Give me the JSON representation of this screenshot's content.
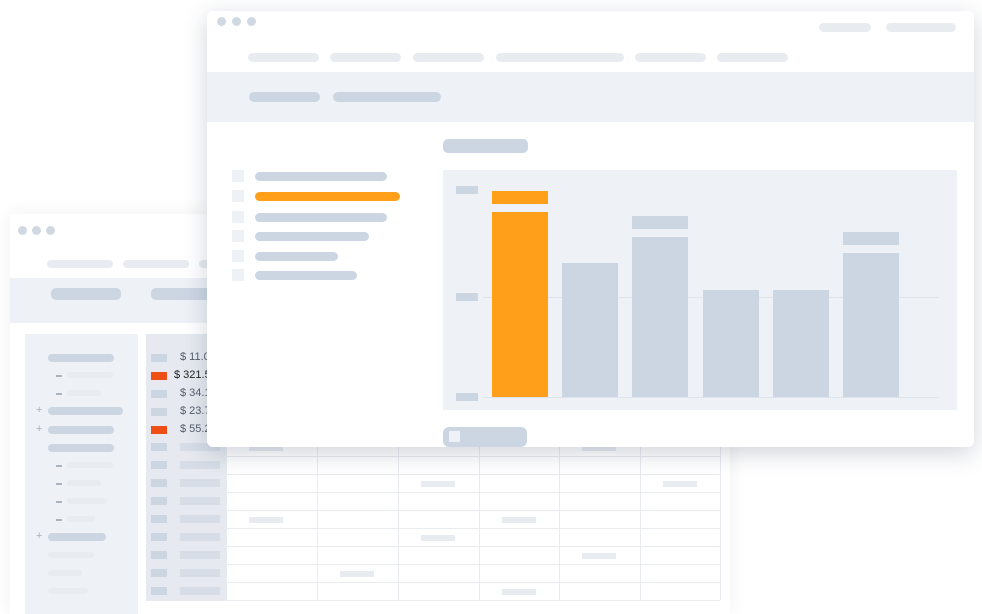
{
  "back_window": {
    "amounts": [
      "$ 11.0",
      "$ 321.5",
      "$ 34.1",
      "$ 23.7",
      "$ 55.2"
    ],
    "highlighted_rows": [
      1,
      4
    ]
  },
  "front_window": {
    "nav_items": 6,
    "active_nav_index": 1
  },
  "chart_data": {
    "type": "bar",
    "categories": [
      "",
      "",
      "",
      "",
      "",
      ""
    ],
    "values": [
      185,
      134,
      160,
      107,
      107,
      144
    ],
    "highlight_index": 0,
    "ylim": [
      0,
      200
    ],
    "grid": true,
    "colors": {
      "bar": "#ccd6e3",
      "highlight": "#ff9f1a"
    }
  },
  "colors": {
    "accent": "#ff9f1a",
    "alert": "#f04e17",
    "placeholder": "#ccd6e3",
    "panel": "#eef1f6"
  }
}
